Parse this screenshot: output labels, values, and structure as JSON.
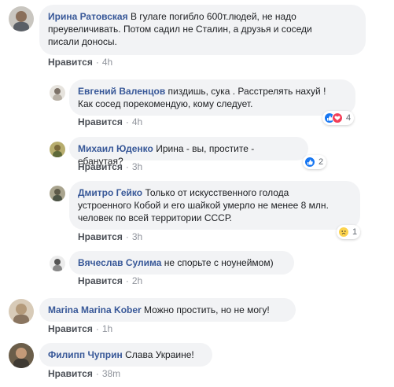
{
  "colors": {
    "name": "#385898",
    "bubble": "#f2f3f5",
    "like_reaction": "#1877f2",
    "love_reaction": "#f33e58"
  },
  "comments": [
    {
      "author": "Ирина Ратовская",
      "lines": [
        "В гулаге погибло 600т.людей, не надо",
        "преувеличивать. Потом садил не Сталин, а друзья и соседи",
        "писали доносы."
      ],
      "like_label": "Нравится",
      "time": "4h"
    },
    {
      "author": "Евгений Валенцов",
      "lines": [
        "пиздишь, сука . Расстрелять нахуй !",
        "Как сосед порекомендую, кому следует."
      ],
      "like_label": "Нравится",
      "time": "4h",
      "reactions": {
        "icons": [
          "like-icon",
          "love-icon"
        ],
        "count": "4"
      }
    },
    {
      "author": "Михаил Юденко",
      "lines": [
        "Ирина - вы, простите - ебанутая?"
      ],
      "like_label": "Нравится",
      "time": "3h",
      "reactions": {
        "icons": [
          "like-icon"
        ],
        "count": "2"
      }
    },
    {
      "author": "Дмитро Гейко",
      "lines": [
        "Только от искусственного голода",
        "устроенного Кобой и его шайкой умерло не менее 8 млн.",
        "человек по всей территории СССР."
      ],
      "like_label": "Нравится",
      "time": "3h",
      "reactions": {
        "icons": [
          "sad-icon"
        ],
        "count": "1"
      }
    },
    {
      "author": "Вячеслав Сулима",
      "lines": [
        "не спорьте с ноунеймом)"
      ],
      "like_label": "Нравится",
      "time": "2h"
    },
    {
      "author": "Marina Marina Kober",
      "lines": [
        "Можно простить, но не могу!"
      ],
      "like_label": "Нравится",
      "time": "1h"
    },
    {
      "author": "Филипп Чуприн",
      "lines": [
        "Слава Украине!"
      ],
      "like_label": "Нравится",
      "time": "38m"
    }
  ]
}
